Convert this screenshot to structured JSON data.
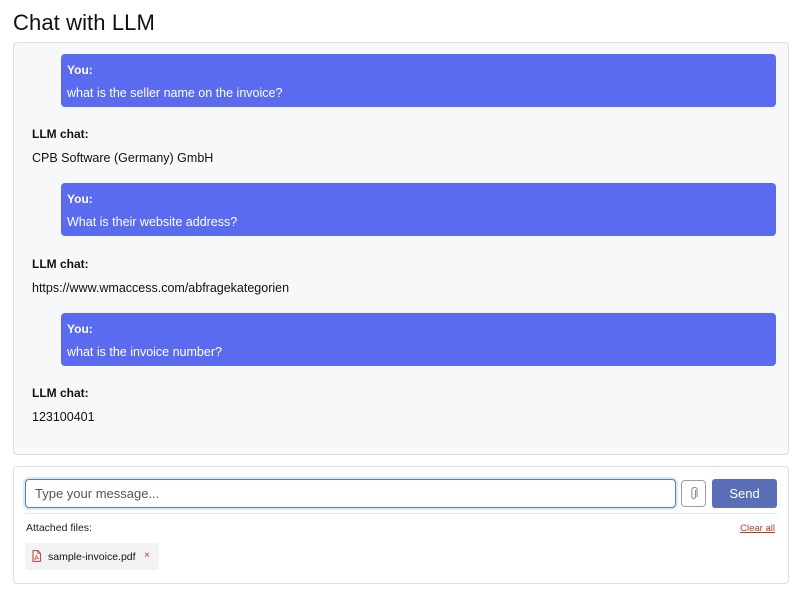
{
  "title": "Chat with LLM",
  "messages": [
    {
      "role": "user",
      "sender": "You:",
      "text": "what is the seller name on the invoice?"
    },
    {
      "role": "llm",
      "sender": "LLM chat:",
      "text": "CPB Software (Germany) GmbH"
    },
    {
      "role": "user",
      "sender": "You:",
      "text": "What is their website address?"
    },
    {
      "role": "llm",
      "sender": "LLM chat:",
      "text": "https://www.wmaccess.com/abfragekategorien"
    },
    {
      "role": "user",
      "sender": "You:",
      "text": "what is the invoice number?"
    },
    {
      "role": "llm",
      "sender": "LLM chat:",
      "text": "123100401"
    }
  ],
  "composer": {
    "placeholder": "Type your message...",
    "value": "",
    "attach_icon": "paperclip-icon",
    "send_label": "Send"
  },
  "attachments": {
    "label": "Attached files:",
    "clear_label": "Clear all",
    "files": [
      {
        "name": "sample-invoice.pdf",
        "icon": "pdf-file-icon",
        "remove_label": "×"
      }
    ]
  },
  "colors": {
    "user_bubble": "#5a6bef",
    "send_button": "#5a6fb8",
    "input_focus": "#4a7ee8",
    "danger_text": "#c0392b"
  }
}
